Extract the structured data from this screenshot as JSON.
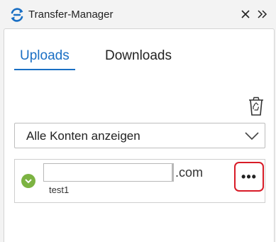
{
  "window": {
    "title": "Transfer-Manager",
    "close_icon": "close-icon",
    "expand_icon": "double-chevron-right-icon",
    "accent_color": "#1a6fc4"
  },
  "tabs": [
    {
      "label": "Uploads",
      "active": true
    },
    {
      "label": "Downloads",
      "active": false
    }
  ],
  "toolbar": {
    "trash_icon": "recycle-bin-icon"
  },
  "filter": {
    "selected": "Alle Konten anzeigen",
    "chevron_icon": "chevron-down-icon"
  },
  "accounts": [
    {
      "email_domain": ".com",
      "name": "test1",
      "status": "ok",
      "status_color": "#7cb342",
      "more_label": "•••",
      "highlight_color": "#d81b27"
    }
  ]
}
